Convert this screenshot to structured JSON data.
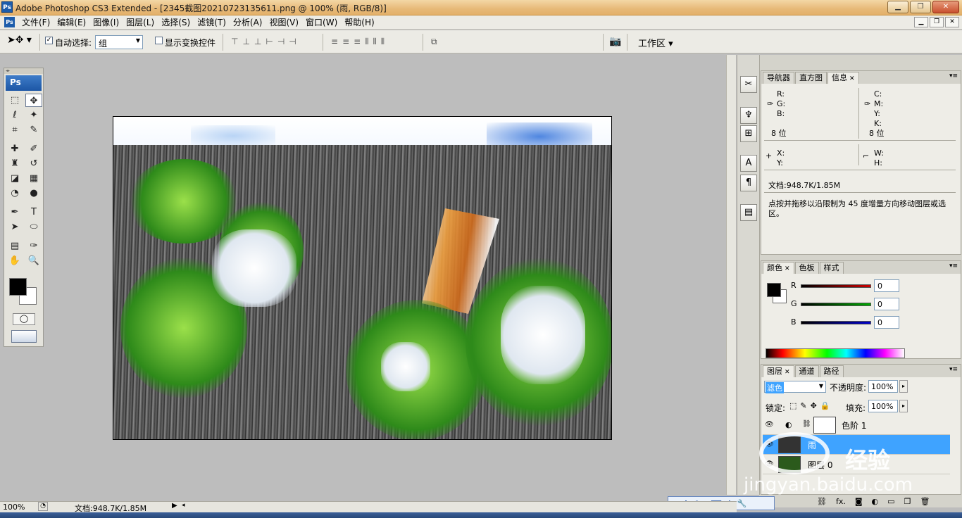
{
  "window": {
    "app_icon": "Ps",
    "title": "Adobe Photoshop CS3 Extended - [2345截图20210723135611.png @ 100% (雨, RGB/8)]",
    "controls": [
      "▁",
      "❐",
      "✕"
    ]
  },
  "menu": {
    "items": [
      "文件(F)",
      "编辑(E)",
      "图像(I)",
      "图层(L)",
      "选择(S)",
      "滤镜(T)",
      "分析(A)",
      "视图(V)",
      "窗口(W)",
      "帮助(H)"
    ],
    "doc_controls": [
      "▁",
      "❐",
      "✕"
    ]
  },
  "options": {
    "tool_icon": "move-icon",
    "auto_select_label": "自动选择:",
    "auto_select_checked": true,
    "auto_select_value": "组",
    "show_transform_label": "显示变换控件",
    "show_transform_checked": false,
    "workspace_label": "工作区 ▾"
  },
  "toolbox": {
    "header": "Ps",
    "tools": [
      {
        "name": "marquee-icon",
        "glyph": "⬚"
      },
      {
        "name": "move-icon",
        "glyph": "✥"
      },
      {
        "name": "lasso-icon",
        "glyph": "ℓ"
      },
      {
        "name": "magic-wand-icon",
        "glyph": "✦"
      },
      {
        "name": "crop-icon",
        "glyph": "⌗"
      },
      {
        "name": "slice-icon",
        "glyph": "✎"
      },
      {
        "name": "healing-brush-icon",
        "glyph": "✚"
      },
      {
        "name": "brush-icon",
        "glyph": "✐"
      },
      {
        "name": "clone-stamp-icon",
        "glyph": "♜"
      },
      {
        "name": "history-brush-icon",
        "glyph": "↺"
      },
      {
        "name": "eraser-icon",
        "glyph": "◪"
      },
      {
        "name": "gradient-icon",
        "glyph": "▦"
      },
      {
        "name": "blur-icon",
        "glyph": "◔"
      },
      {
        "name": "dodge-icon",
        "glyph": "●"
      },
      {
        "name": "pen-icon",
        "glyph": "✒"
      },
      {
        "name": "type-icon",
        "glyph": "T"
      },
      {
        "name": "path-select-icon",
        "glyph": "➤"
      },
      {
        "name": "shape-icon",
        "glyph": "⬭"
      },
      {
        "name": "notes-icon",
        "glyph": "▤"
      },
      {
        "name": "eyedropper-icon",
        "glyph": "✑"
      },
      {
        "name": "hand-icon",
        "glyph": "✋"
      },
      {
        "name": "zoom-icon",
        "glyph": "🔍"
      }
    ]
  },
  "info_panel": {
    "tabs": [
      "导航器",
      "直方图",
      "信息"
    ],
    "active_tab": "信息",
    "rgb_labels": [
      "R:",
      "G:",
      "B:"
    ],
    "cmyk_labels": [
      "C:",
      "M:",
      "Y:",
      "K:"
    ],
    "bit_left": "8 位",
    "bit_right": "8 位",
    "xy_labels": [
      "X:",
      "Y:"
    ],
    "wh_labels": [
      "W:",
      "H:"
    ],
    "doc_size": "文档:948.7K/1.85M",
    "hint": "点按并拖移以沿限制为 45 度增量方向移动图层或选区。"
  },
  "color_panel": {
    "tabs": [
      "颜色",
      "色板",
      "样式"
    ],
    "active_tab": "颜色",
    "channels": [
      {
        "label": "R",
        "value": "0",
        "color": "#cc0000"
      },
      {
        "label": "G",
        "value": "0",
        "color": "#00aa00"
      },
      {
        "label": "B",
        "value": "0",
        "color": "#0000cc"
      }
    ]
  },
  "layers_panel": {
    "tabs": [
      "图层",
      "通道",
      "路径"
    ],
    "active_tab": "图层",
    "blend_mode": "滤色",
    "opacity_label": "不透明度:",
    "opacity": "100%",
    "lock_label": "锁定:",
    "fill_label": "填充:",
    "fill": "100%",
    "layers": [
      {
        "name": "色阶 1",
        "type": "adjustment"
      },
      {
        "name": "雨",
        "type": "pixel",
        "selected": true
      },
      {
        "name": "图层 0",
        "type": "pixel"
      }
    ],
    "bottom_icons": [
      "link-icon",
      "fx-icon",
      "mask-icon",
      "adjustment-icon",
      "group-icon",
      "new-layer-icon",
      "trash-icon"
    ]
  },
  "status": {
    "zoom": "100%",
    "doc_size": "文档:948.7K/1.85M"
  },
  "watermark": {
    "text": "经验",
    "url": "jingyan.baidu.com"
  },
  "colors": {
    "accent": "#3fa3ff",
    "titlebar": "#e7b978"
  }
}
